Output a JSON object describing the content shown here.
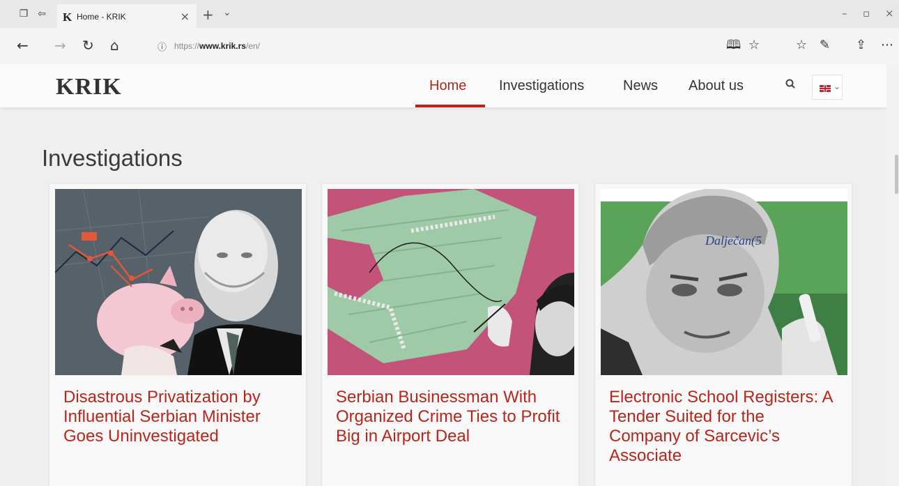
{
  "browser": {
    "tab_title": "Home - KRIK",
    "tab_favicon": "K",
    "url_plain": "https://",
    "url_domain": "www.krik.rs",
    "url_path": "/en/",
    "icons": [
      "tab-preview-icon",
      "set-aside-icon",
      "close-icon",
      "new-tab-icon",
      "chevron-down-icon",
      "minimize-icon",
      "maximize-icon",
      "back-icon",
      "forward-icon",
      "refresh-icon",
      "home-icon",
      "info-icon",
      "reading-view-icon",
      "favorite-star-icon",
      "favorites-icon",
      "pen-icon",
      "share-icon",
      "more-icon"
    ]
  },
  "site": {
    "logo": "KRIK",
    "nav": [
      {
        "label": "Home",
        "active": true
      },
      {
        "label": "Investigations",
        "active": false
      },
      {
        "label": "News",
        "active": false
      },
      {
        "label": "About us",
        "active": false
      }
    ],
    "accent_color": "#b8261b",
    "language": "en-gb-flag"
  },
  "section": {
    "title": "Investigations",
    "cards": [
      {
        "title": "Disastrous Privatization by Influential Serbian Minister Goes Uninvestigated"
      },
      {
        "title": "Serbian Businessman With Organized Crime Ties to Profit Big in Airport Deal"
      },
      {
        "title": "Electronic School Registers: A Tender Suited for the Company of Sarcevic’s Associate",
        "image_text": "Dalječan(5"
      }
    ]
  }
}
